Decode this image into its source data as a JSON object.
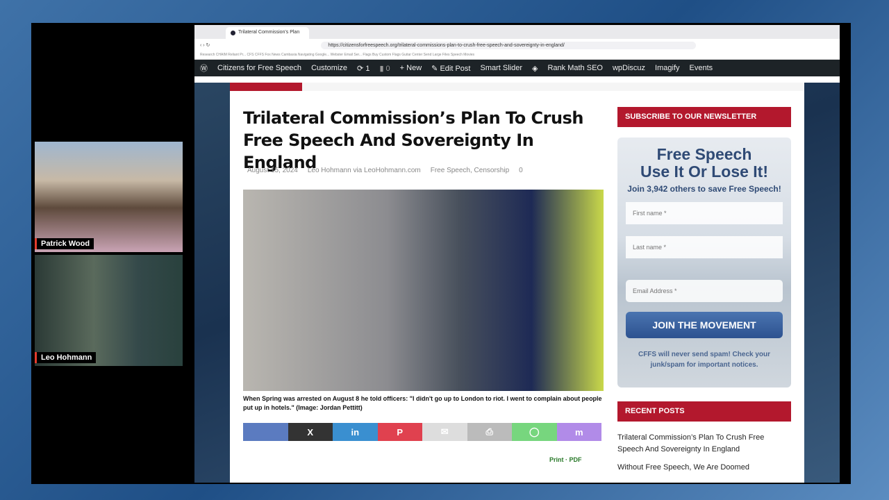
{
  "participants": [
    {
      "name": "Patrick Wood"
    },
    {
      "name": "Leo Hohmann"
    }
  ],
  "browser": {
    "tab_title": "Trilateral Commission's Plan",
    "url": "https://citizensforfreespeech.org/trilateral-commissions-plan-to-crush-free-speech-and-sovereignty-in-england/",
    "bookmarks": "Research  CHAIM Reliant Pr...  CFS CFFS  Fox News  Cambasia  Navigating Google...  Webster Email Ser...  Flags  Buy Custom Flags  Guitar Center  Send Large Files  Speech  Movies"
  },
  "wp_admin": {
    "items": [
      "Citizens for Free Speech",
      "Customize",
      "1",
      "0",
      "New",
      "Edit Post",
      "Smart Slider",
      "Rank Math SEO",
      "wpDiscuz",
      "Imagify",
      "Events"
    ]
  },
  "article": {
    "title": "Trilateral Commission’s Plan To Crush Free Speech And Sovereignty In England",
    "date": "August 15, 2024",
    "author": "Leo Hohmann via LeoHohmann.com",
    "categories": "Free Speech, Censorship",
    "comments": "0",
    "caption": "When Spring was arrested on August 8 he told officers: \"I didn't go up to London to riot. I went to complain about people put up in hotels.\" (Image: Jordan Pettitt)",
    "print_label": "Print",
    "pdf_label": "PDF",
    "share": [
      {
        "icon": "facebook",
        "color": "#5b7bc0"
      },
      {
        "icon": "x",
        "label": "X",
        "color": "#333333"
      },
      {
        "icon": "linkedin",
        "label": "in",
        "color": "#3a8fd0"
      },
      {
        "icon": "pinterest",
        "label": "P",
        "color": "#e0414f"
      },
      {
        "icon": "email",
        "label": "✉",
        "color": "#dddddd"
      },
      {
        "icon": "print",
        "label": "⎙",
        "color": "#bbbbbb"
      },
      {
        "icon": "whatsapp",
        "label": "◯",
        "color": "#77d67e"
      },
      {
        "icon": "mastodon",
        "label": "m",
        "color": "#b18be8"
      }
    ]
  },
  "sidebar": {
    "newsletter_heading": "SUBSCRIBE TO OUR NEWSLETTER",
    "form_title_1": "Free Speech",
    "form_title_2": "Use It Or Lose It!",
    "form_subtitle": "Join 3,942 others to save Free Speech!",
    "first_name_placeholder": "First name *",
    "last_name_placeholder": "Last name *",
    "email_placeholder": "Email Address *",
    "join_button": "JOIN THE MOVEMENT",
    "note": "CFFS will never send spam! Check your junk/spam for important notices.",
    "recent_heading": "RECENT POSTS",
    "recent_posts": [
      "Trilateral Commission’s Plan To Crush Free Speech And Sovereignty In England",
      "Without Free Speech, We Are Doomed"
    ]
  }
}
